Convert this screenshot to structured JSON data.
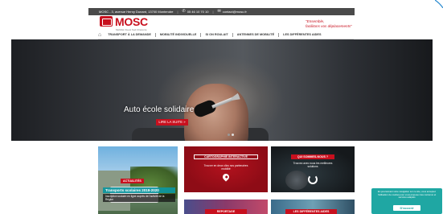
{
  "topbar": {
    "address": "MOSC - 3, avenue Henry Dunant, 13700 Montendre",
    "phone": "05 46 10 70 10",
    "email": "contact@mosc.fr"
  },
  "logo": {
    "name": "MOSC",
    "subtitle": "Mobilité Ouest Sud Charente"
  },
  "tagline": {
    "line1": "\"Ensemble,",
    "line2": "facilitons vos déplacements\""
  },
  "nav": [
    "TRANSPORT À LA DEMANDE",
    "MOBILITÉ INDIVIDUELLE",
    "SI ON ROULAIT",
    "ANTENNES DE MOBILITÉ",
    "LES DIFFÉRENTES AIDES"
  ],
  "hero": {
    "title": "Auto école solidaire",
    "button": "LIRE LA SUITE »",
    "slides": 2,
    "active_slide": 2
  },
  "tiles": {
    "news": {
      "badge": "ACTUALITÉS",
      "title": "Transports scolaires 2019-2020",
      "text": "Inscription scolaire en ligne auprès de l'activité de la Région"
    },
    "map": {
      "header": "CARTOGRAPHIE INTERACTIVE",
      "sub": "Trouver en deux clics nos partenaires mobilité"
    },
    "who": {
      "header": "QUI SOMMES-NOUS ?",
      "sub": "Trouvez avec nous les meilleures solutions"
    },
    "report": {
      "header": "REPORTAGE"
    },
    "aids": {
      "header": "LES DIFFÉRENTES AIDES"
    }
  },
  "cookie": {
    "text": "En poursuivant votre navigation sur ce site, vous acceptez l'utilisation de cookies pour vous proposer des contenus et services adaptés",
    "button": "D'accord"
  },
  "colors": {
    "brand": "#c8101e",
    "topbar": "#4a4a4a",
    "cookie": "#1fa7a3"
  }
}
